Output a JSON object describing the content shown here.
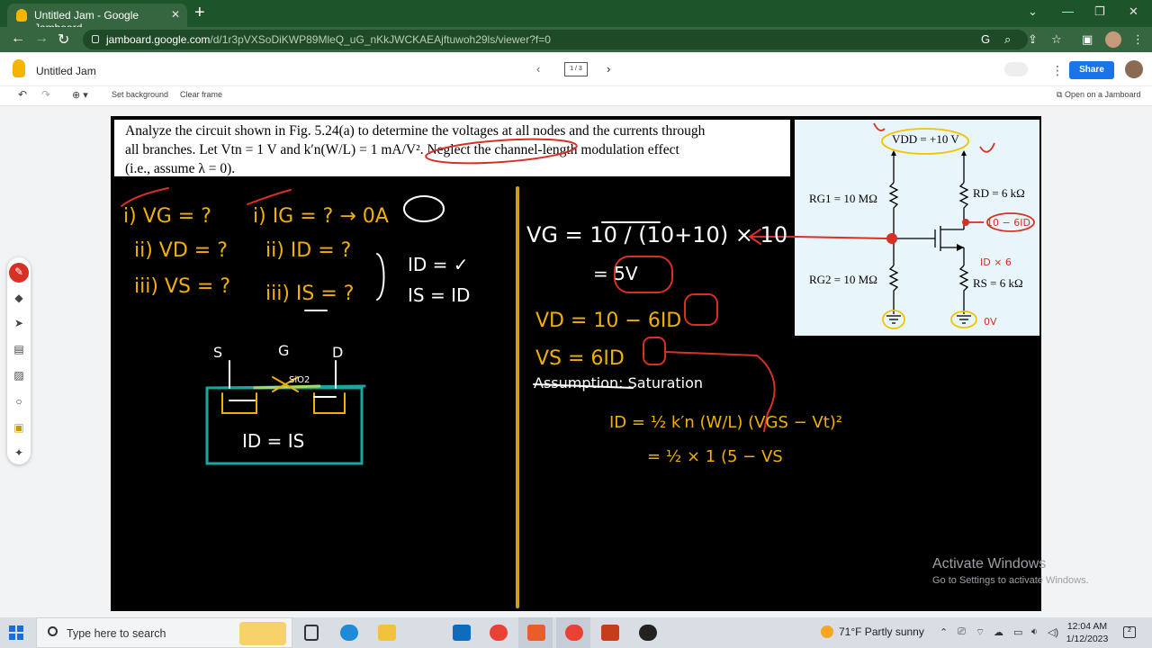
{
  "browser": {
    "tab_title": "Untitled Jam - Google Jamboard",
    "tab_close": "✕",
    "new_tab": "+",
    "url_host": "jamboard.google.com",
    "url_path": "/d/1r3pVXSoDiKWP89MleQ_uG_nKkJWCKAEAjftuwoh29ls/viewer?f=0",
    "window_controls": [
      "⌄",
      "—",
      "❐",
      "✕"
    ]
  },
  "app": {
    "title": "Untitled Jam",
    "frame_indicator": "1 / 3",
    "share_label": "Share",
    "toolbar": {
      "set_background": "Set background",
      "clear_frame": "Clear frame",
      "open_on_jamboard": "Open on a Jamboard"
    }
  },
  "slide": {
    "problem_text_1": "Analyze the circuit shown in Fig. 5.24(a) to determine the voltages at all nodes and the currents through",
    "problem_text_2": "all branches. Let Vtn = 1 V and k′n(W/L) = 1 mA/V². Neglect the channel-length modulation effect",
    "problem_text_3": "(i.e., assume λ = 0).",
    "circuit": {
      "vdd": "VDD = +10 V",
      "rg1": "RG1 = 10 MΩ",
      "rd": "RD = 6 kΩ",
      "rg2": "RG2 = 10 MΩ",
      "rs": "RS = 6 kΩ"
    },
    "handwritten_notes": [
      "i) VG = ?",
      "ii) VD = ?",
      "iii) VS = ?",
      "i) IG = ? → 0A",
      "ii) ID = ?",
      "iii) IS = ?",
      "ID = ✓",
      "IS = ID",
      "S",
      "G",
      "D",
      "SiO2",
      "ID = IS",
      "VG = 10 / (10+10) × 10",
      "= 5V",
      "VD = 10 − 6ID",
      "VS = 6ID",
      "Assumption: Saturation",
      "ID = ½ k′n (W/L) (VGS − Vt)²",
      "= ½ × 1 (5 − VS",
      "10 − 6ID",
      "ID × 6",
      "0V"
    ]
  },
  "watermark": {
    "line1": "Activate Windows",
    "line2": "Go to Settings to activate Windows."
  },
  "taskbar": {
    "search_placeholder": "Type here to search",
    "weather": "71°F  Partly sunny",
    "time": "12:04 AM",
    "date": "1/12/2023",
    "notification_count": "2"
  }
}
